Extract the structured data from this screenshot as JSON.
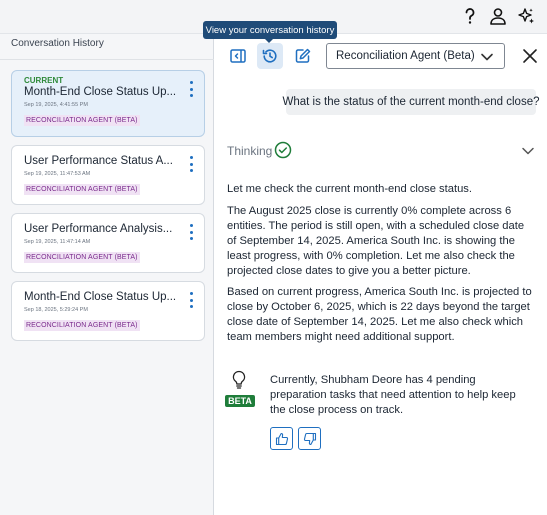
{
  "header": {
    "icons": [
      "help-icon",
      "user-icon",
      "sparkle-icon"
    ]
  },
  "sidebar": {
    "title": "Conversation History",
    "conversations": [
      {
        "current_label": "CURRENT",
        "title": "Month-End Close Status Up...",
        "date": "Sep 19, 2025, 4:41:55 PM",
        "agent": "RECONCILIATION AGENT (BETA)"
      },
      {
        "title": "User Performance Status A...",
        "date": "Sep 19, 2025, 11:47:53 AM",
        "agent": "RECONCILIATION AGENT (BETA)"
      },
      {
        "title": "User Performance Analysis...",
        "date": "Sep 19, 2025, 11:47:14 AM",
        "agent": "RECONCILIATION AGENT (BETA)"
      },
      {
        "title": "Month-End Close Status Up...",
        "date": "Sep 18, 2025, 5:29:24 PM",
        "agent": "RECONCILIATION AGENT (BETA)"
      }
    ]
  },
  "tooltip": "View your conversation history",
  "toolbar": {
    "agent_selected": "Reconciliation Agent (Beta)"
  },
  "chat": {
    "user_message": "What is the status of the current month-end close?",
    "thinking_label": "Thinking",
    "thinking_paragraphs": [
      "Let me check the current month-end close status.",
      "The August 2025 close is currently 0% complete across 6 entities. The period is still open, with a scheduled close date of September 14, 2025. America South Inc. is showing the least progress, with 0% completion. Let me also check the projected close dates to give you a better picture.",
      "Based on current progress, America South Inc. is projected to close by October 6, 2025, which is 22 days beyond the target close date of September 14, 2025. Let me also check which team members might need additional support."
    ],
    "beta_label": "BETA",
    "answer": "Currently, Shubham Deore has 4 pending preparation tasks that need attention to help keep the close process on track."
  },
  "colors": {
    "accent": "#1f6fc0",
    "current_tag": "#2f8a3a",
    "agent_badge_text": "#7a2a8c",
    "beta_badge": "#1f7d3a",
    "tooltip_bg": "#1f4b78"
  }
}
